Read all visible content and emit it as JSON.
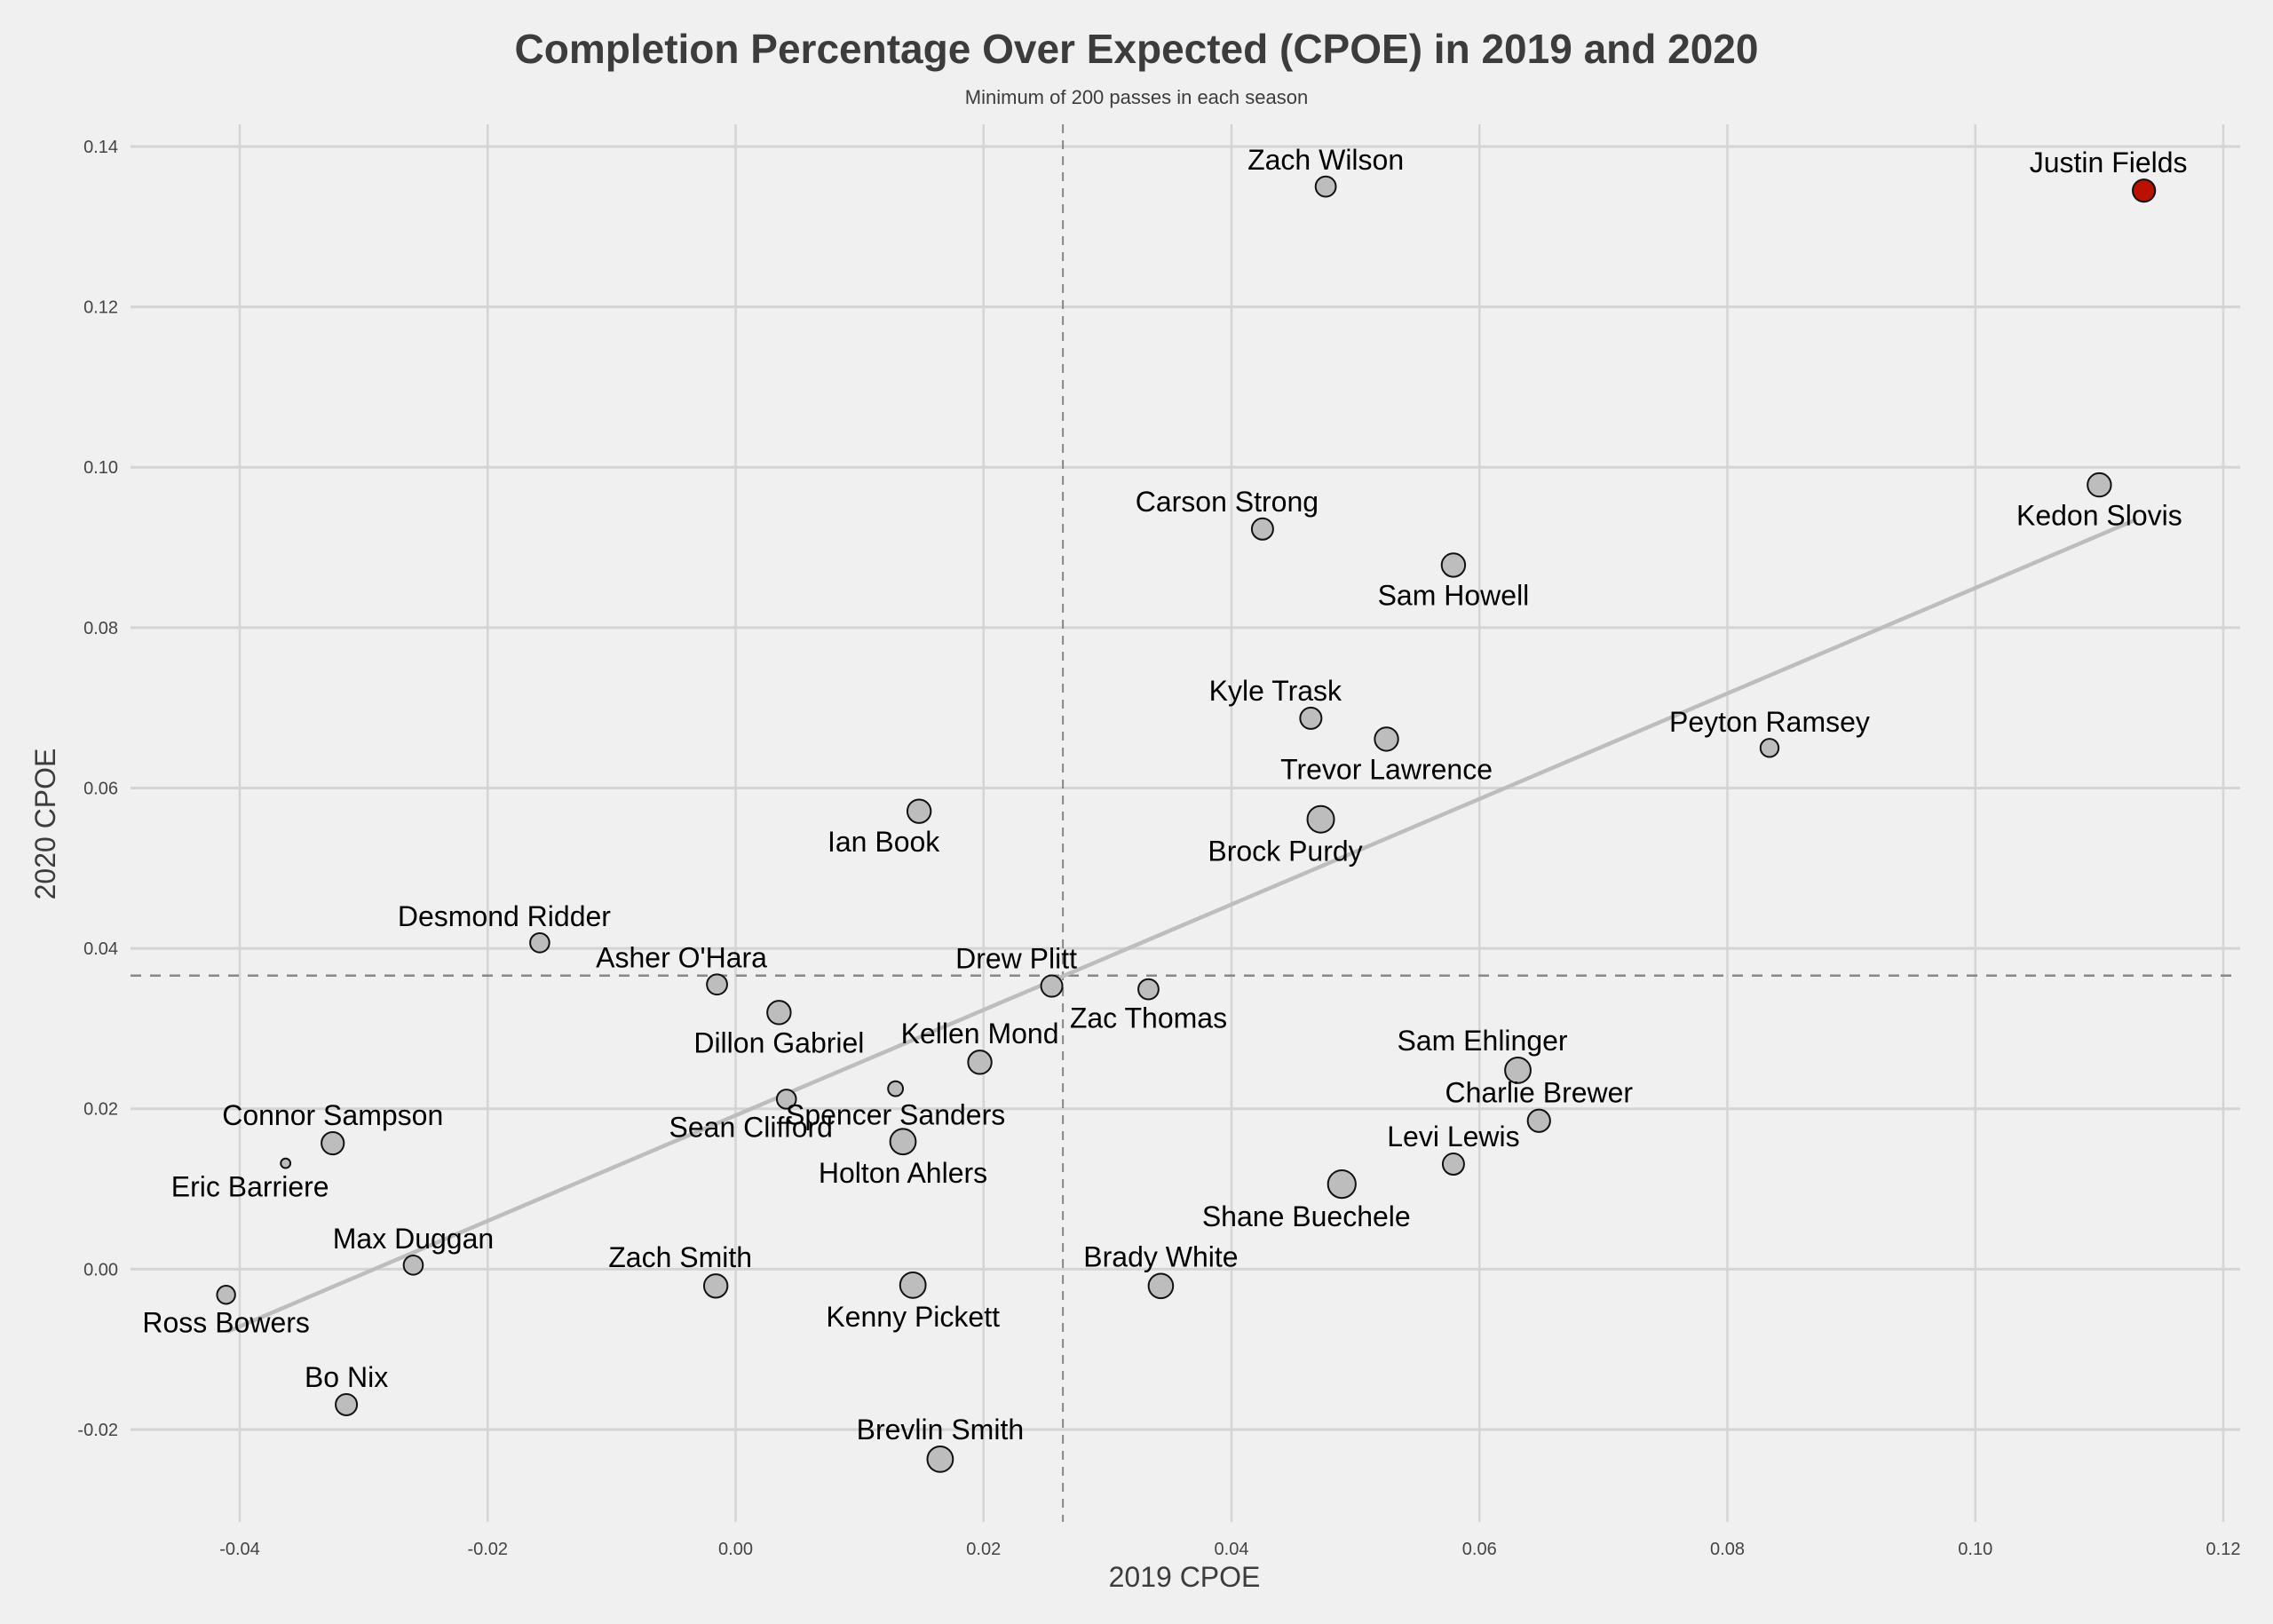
{
  "chart_data": {
    "type": "scatter",
    "title": "Completion Percentage Over Expected (CPOE) in 2019 and 2020",
    "subtitle": "Minimum of 200 passes in each season",
    "xlabel": "2019 CPOE",
    "ylabel": "2020 CPOE",
    "xlim": [
      -0.048,
      0.122
    ],
    "ylim": [
      -0.031,
      0.145
    ],
    "xticks": [
      -0.04,
      -0.02,
      0.0,
      0.02,
      0.04,
      0.06,
      0.08,
      0.1,
      0.12
    ],
    "xtick_labels": [
      "-0.04",
      "-0.02",
      "0.00",
      "0.02",
      "0.04",
      "0.06",
      "0.08",
      "0.10",
      "0.12"
    ],
    "yticks": [
      -0.02,
      0.0,
      0.02,
      0.04,
      0.06,
      0.08,
      0.1,
      0.12,
      0.14
    ],
    "ytick_labels": [
      "-0.02",
      "0.00",
      "0.02",
      "0.04",
      "0.06",
      "0.08",
      "0.10",
      "0.12",
      "0.14"
    ],
    "grid": true,
    "mean_lines": {
      "x": 0.0264,
      "y": 0.0366,
      "style": "dashed"
    },
    "trend_line": {
      "x": [
        -0.041,
        0.113
      ],
      "y": [
        -0.0078,
        0.0935
      ]
    },
    "colors": {
      "default_fill": "#bdbdbd",
      "highlight_fill": "#bb1100",
      "stroke": "#111111",
      "trend": "#bdbdbd",
      "mean_line": "#888888",
      "grid": "#d4d4d4",
      "background": "#f0f0f0"
    },
    "points": [
      {
        "name": "Justin Fields",
        "x": 0.1136,
        "y": 0.1345,
        "size": 0.8,
        "highlight": true,
        "label_pos": "above-left"
      },
      {
        "name": "Zach Wilson",
        "x": 0.0476,
        "y": 0.135,
        "size": 0.7,
        "label_pos": "above"
      },
      {
        "name": "Kedon Slovis",
        "x": 0.11,
        "y": 0.0978,
        "size": 0.85,
        "label_pos": "below"
      },
      {
        "name": "Carson Strong",
        "x": 0.0425,
        "y": 0.0923,
        "size": 0.75,
        "label_pos": "above-left"
      },
      {
        "name": "Sam Howell",
        "x": 0.0579,
        "y": 0.0878,
        "size": 0.85,
        "label_pos": "below"
      },
      {
        "name": "Kyle Trask",
        "x": 0.0464,
        "y": 0.0687,
        "size": 0.75,
        "label_pos": "above-left"
      },
      {
        "name": "Trevor Lawrence",
        "x": 0.0525,
        "y": 0.0661,
        "size": 0.85,
        "label_pos": "below"
      },
      {
        "name": "Peyton Ramsey",
        "x": 0.0834,
        "y": 0.065,
        "size": 0.6,
        "label_pos": "above"
      },
      {
        "name": "Brock Purdy",
        "x": 0.0472,
        "y": 0.0561,
        "size": 1.0,
        "label_pos": "below-left"
      },
      {
        "name": "Ian Book",
        "x": 0.0148,
        "y": 0.0571,
        "size": 0.85,
        "label_pos": "below-left"
      },
      {
        "name": "Desmond Ridder",
        "x": -0.0158,
        "y": 0.0407,
        "size": 0.65,
        "label_pos": "above-left"
      },
      {
        "name": "Asher O'Hara",
        "x": -0.0015,
        "y": 0.0355,
        "size": 0.7,
        "label_pos": "above-left"
      },
      {
        "name": "Drew Plitt",
        "x": 0.0255,
        "y": 0.0353,
        "size": 0.75,
        "label_pos": "above-left"
      },
      {
        "name": "Zac Thomas",
        "x": 0.0333,
        "y": 0.0349,
        "size": 0.7,
        "label_pos": "below"
      },
      {
        "name": "Dillon Gabriel",
        "x": 0.0035,
        "y": 0.032,
        "size": 0.85,
        "label_pos": "below"
      },
      {
        "name": "Kellen Mond",
        "x": 0.0197,
        "y": 0.0258,
        "size": 0.85,
        "label_pos": "above"
      },
      {
        "name": "Sam Ehlinger",
        "x": 0.0631,
        "y": 0.0248,
        "size": 0.95,
        "label_pos": "above-left"
      },
      {
        "name": "Sean Clifford",
        "x": 0.0041,
        "y": 0.0212,
        "size": 0.65,
        "label_pos": "below-left"
      },
      {
        "name": "Spencer Sanders",
        "x": 0.0129,
        "y": 0.0225,
        "size": 0.45,
        "label_pos": "below"
      },
      {
        "name": "Charlie Brewer",
        "x": 0.0648,
        "y": 0.0185,
        "size": 0.8,
        "label_pos": "above"
      },
      {
        "name": "Connor Sampson",
        "x": -0.0325,
        "y": 0.0157,
        "size": 0.8,
        "label_pos": "above"
      },
      {
        "name": "Holton Ahlers",
        "x": 0.0135,
        "y": 0.0159,
        "size": 0.95,
        "label_pos": "below"
      },
      {
        "name": "Eric Barriere",
        "x": -0.0363,
        "y": 0.0132,
        "size": 0.2,
        "label_pos": "below-left"
      },
      {
        "name": "Levi Lewis",
        "x": 0.0579,
        "y": 0.0131,
        "size": 0.75,
        "label_pos": "above"
      },
      {
        "name": "Shane Buechele",
        "x": 0.0489,
        "y": 0.0106,
        "size": 1.05,
        "label_pos": "below-left"
      },
      {
        "name": "Max Duggan",
        "x": -0.026,
        "y": 0.0005,
        "size": 0.65,
        "label_pos": "above"
      },
      {
        "name": "Zach Smith",
        "x": -0.0016,
        "y": -0.0021,
        "size": 0.85,
        "label_pos": "above-left"
      },
      {
        "name": "Kenny Pickett",
        "x": 0.0143,
        "y": -0.002,
        "size": 0.95,
        "label_pos": "below"
      },
      {
        "name": "Brady White",
        "x": 0.0343,
        "y": -0.0021,
        "size": 0.9,
        "label_pos": "above"
      },
      {
        "name": "Ross Bowers",
        "x": -0.0411,
        "y": -0.0032,
        "size": 0.6,
        "label_pos": "below"
      },
      {
        "name": "Bo Nix",
        "x": -0.0314,
        "y": -0.0169,
        "size": 0.75,
        "label_pos": "above"
      },
      {
        "name": "Brevlin Smith",
        "x": 0.0165,
        "y": -0.0237,
        "size": 0.95,
        "label_pos": "above"
      }
    ]
  }
}
